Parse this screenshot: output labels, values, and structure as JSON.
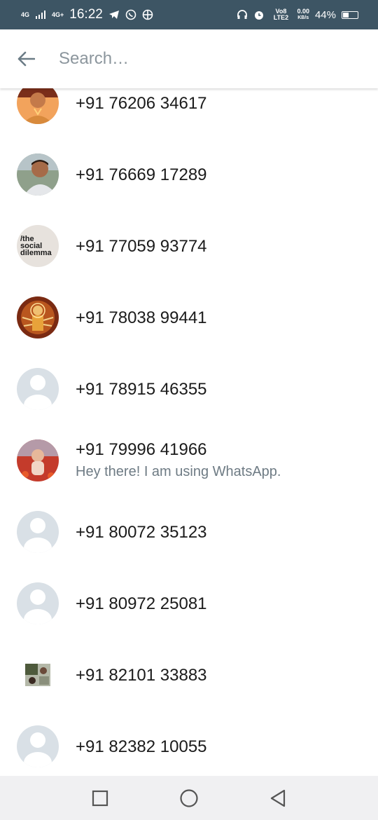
{
  "status_bar": {
    "net1": "4G",
    "net2": "4G+",
    "time": "16:22",
    "volte": "Vo8 LTE2",
    "speed_value": "0.00",
    "speed_unit": "KB/s",
    "battery_percent": "44%",
    "battery_level": 0.44,
    "icons": [
      "signal-icon",
      "signal-icon",
      "telegram-icon",
      "whatsapp-icon",
      "shield-icon",
      "headphones-icon",
      "alarm-icon",
      "battery-icon"
    ]
  },
  "search": {
    "placeholder": "Search…",
    "value": ""
  },
  "contacts": [
    {
      "name": "+91 76206 34617",
      "about": "",
      "avatar": "photo-portrait-orange"
    },
    {
      "name": "+91 76669 17289",
      "about": "",
      "avatar": "photo-portrait-smiling"
    },
    {
      "name": "+91 77059 93774",
      "about": "",
      "avatar": "the-social-dilemma",
      "avatar_text": [
        "/the",
        "social",
        "dilemma"
      ]
    },
    {
      "name": "+91 78038 99441",
      "about": "",
      "avatar": "deity-image"
    },
    {
      "name": "+91 78915 46355",
      "about": "",
      "avatar": "default"
    },
    {
      "name": "+91 79996 41966",
      "about": "Hey there! I am using WhatsApp.",
      "avatar": "photo-baby"
    },
    {
      "name": "+91 80072 35123",
      "about": "",
      "avatar": "default"
    },
    {
      "name": "+91 80972 25081",
      "about": "",
      "avatar": "default"
    },
    {
      "name": "+91 82101 33883",
      "about": "",
      "avatar": "photo-collage"
    },
    {
      "name": "+91 82382 10055",
      "about": "",
      "avatar": "default"
    }
  ],
  "nav": [
    "recents-button",
    "home-button",
    "back-button"
  ]
}
